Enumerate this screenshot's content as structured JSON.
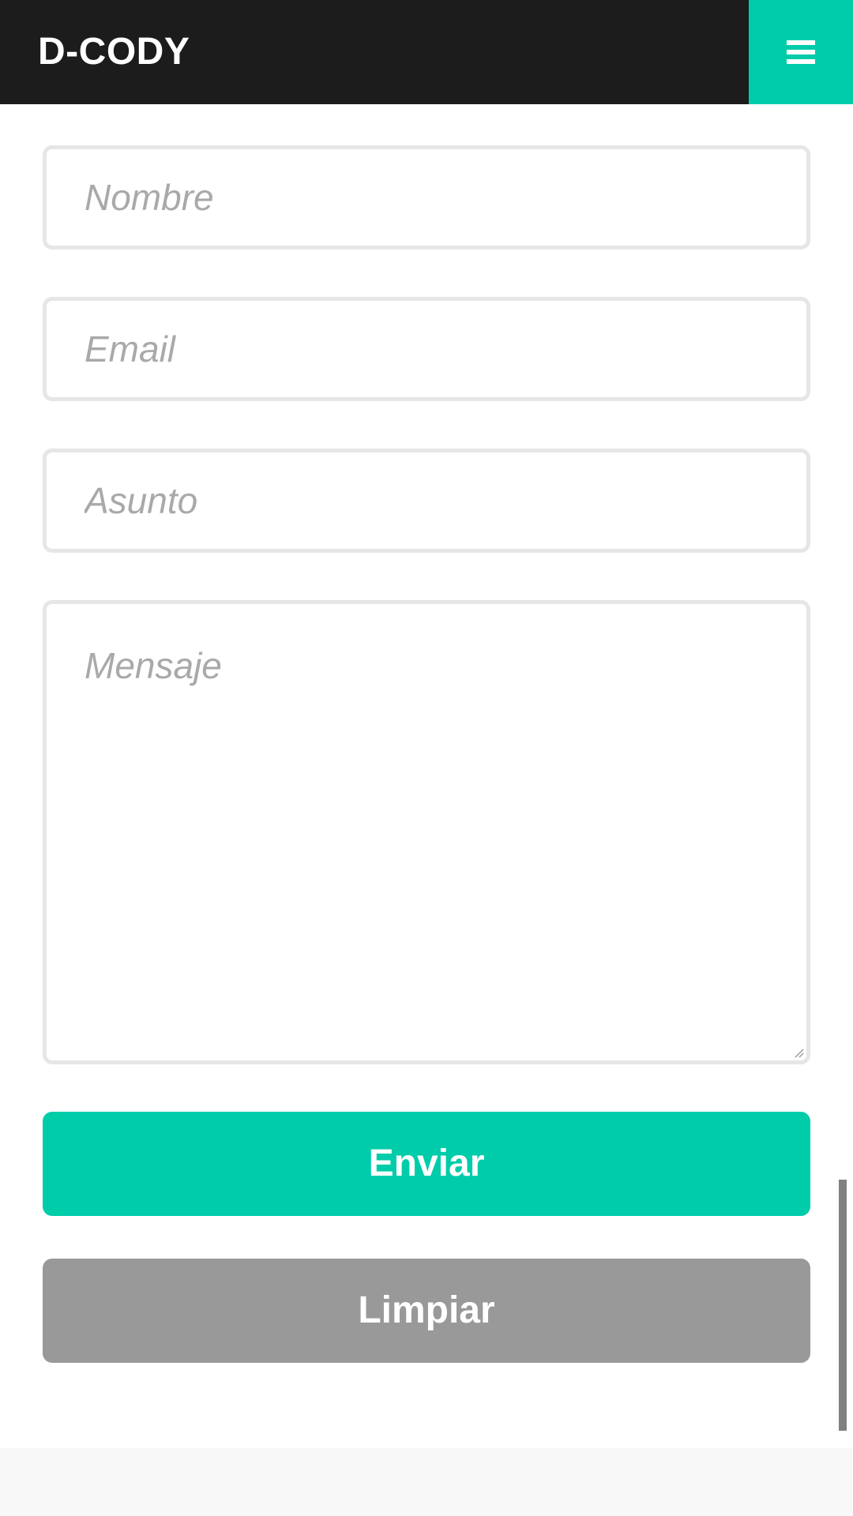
{
  "header": {
    "brand": "D-CODY",
    "menu_icon": "hamburger-menu-icon"
  },
  "contact_form": {
    "name_placeholder": "Nombre",
    "email_placeholder": "Email",
    "subject_placeholder": "Asunto",
    "message_placeholder": "Mensaje",
    "submit_label": "Enviar",
    "clear_label": "Limpiar"
  },
  "colors": {
    "accent": "#00ccaa",
    "header_bg": "#1c1c1c",
    "secondary_button": "#999999",
    "field_border": "#e6e6e6",
    "placeholder_text": "#a9a9a9"
  }
}
